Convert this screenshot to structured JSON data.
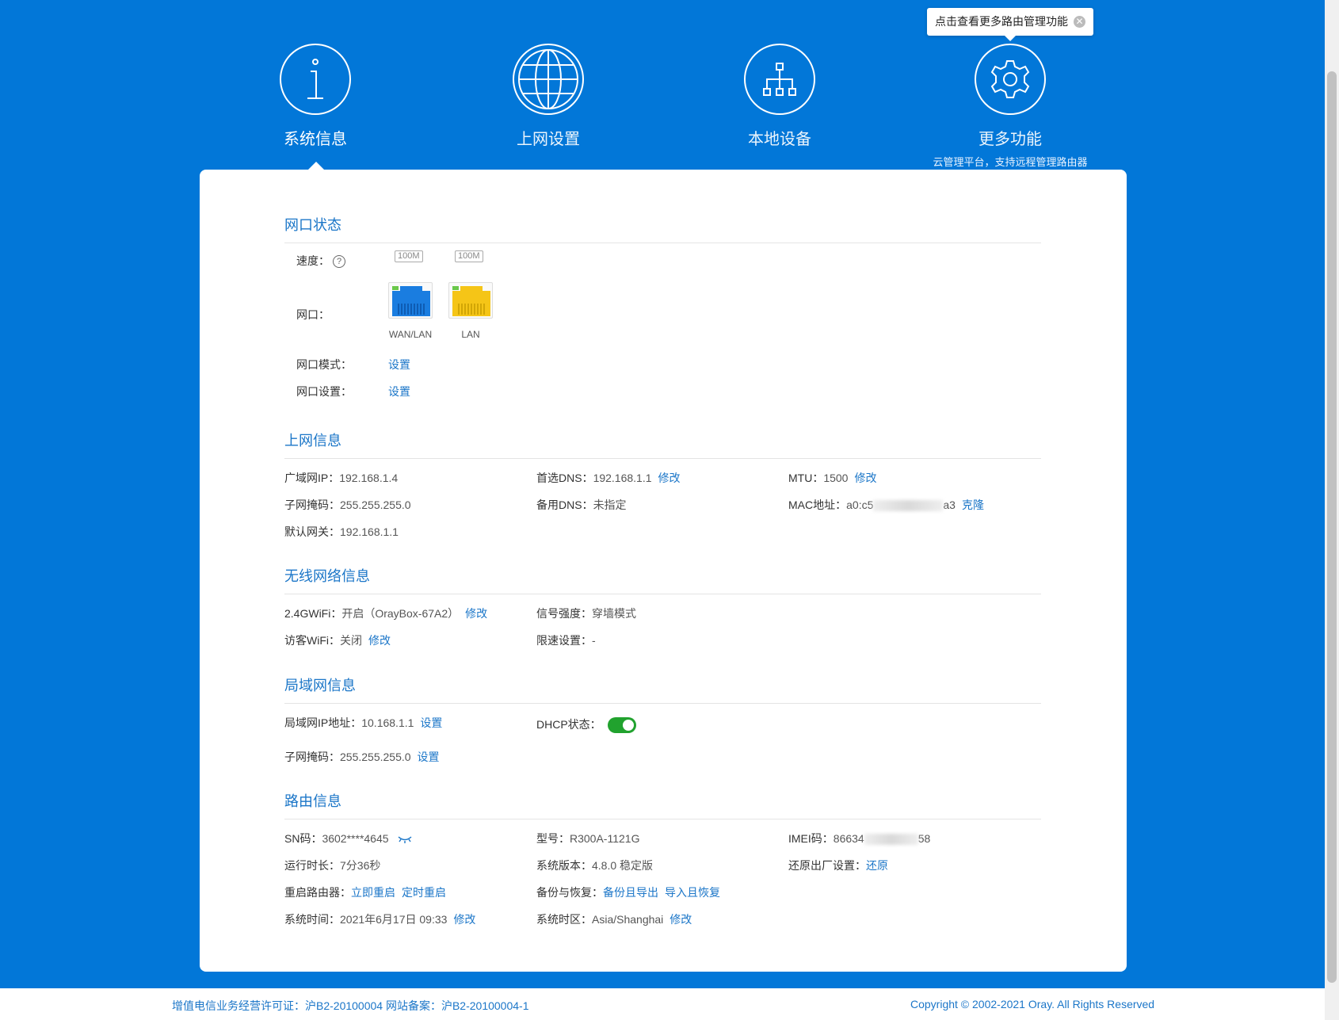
{
  "nav": {
    "items": [
      {
        "label": "系统信息",
        "icon": "info-icon"
      },
      {
        "label": "上网设置",
        "icon": "globe-icon"
      },
      {
        "label": "本地设备",
        "icon": "network-icon"
      },
      {
        "label": "更多功能",
        "icon": "gear-icon",
        "sub": "云管理平台，支持远程管理路由器"
      }
    ],
    "tooltip": "点击查看更多路由管理功能"
  },
  "port_status": {
    "title": "网口状态",
    "speed_label": "速度：",
    "speeds": [
      "100M",
      "100M"
    ],
    "port_label": "网口：",
    "ports": [
      {
        "name": "WAN/LAN",
        "color": "#1a7de0"
      },
      {
        "name": "LAN",
        "color": "#f5c517"
      }
    ],
    "mode_label": "网口模式：",
    "mode_link": "设置",
    "setting_label": "网口设置：",
    "setting_link": "设置"
  },
  "internet": {
    "title": "上网信息",
    "wan_ip_label": "广域网IP：",
    "wan_ip": "192.168.1.4",
    "mask_label": "子网掩码：",
    "mask": "255.255.255.0",
    "gateway_label": "默认网关：",
    "gateway": "192.168.1.1",
    "dns1_label": "首选DNS：",
    "dns1": "192.168.1.1",
    "dns1_link": "修改",
    "dns2_label": "备用DNS：",
    "dns2": "未指定",
    "mtu_label": "MTU：",
    "mtu": "1500",
    "mtu_link": "修改",
    "mac_label": "MAC地址：",
    "mac_prefix": "a0:c5",
    "mac_suffix": "a3",
    "mac_link": "克隆"
  },
  "wireless": {
    "title": "无线网络信息",
    "wifi24_label": "2.4GWiFi：",
    "wifi24": "开启（OrayBox-67A2）",
    "wifi24_link": "修改",
    "guest_label": "访客WiFi：",
    "guest": "关闭",
    "guest_link": "修改",
    "signal_label": "信号强度：",
    "signal": "穿墙模式",
    "limit_label": "限速设置：",
    "limit": "-"
  },
  "lan": {
    "title": "局域网信息",
    "ip_label": "局域网IP地址：",
    "ip": "10.168.1.1",
    "ip_link": "设置",
    "mask_label": "子网掩码：",
    "mask": "255.255.255.0",
    "mask_link": "设置",
    "dhcp_label": "DHCP状态：",
    "dhcp_on": true
  },
  "router": {
    "title": "路由信息",
    "sn_label": "SN码：",
    "sn": "3602****4645",
    "uptime_label": "运行时长：",
    "uptime": "7分36秒",
    "reboot_label": "重启路由器：",
    "reboot_now": "立即重启",
    "reboot_timer": "定时重启",
    "time_label": "系统时间：",
    "time": "2021年6月17日 09:33",
    "time_link": "修改",
    "model_label": "型号：",
    "model": "R300A-1121G",
    "version_label": "系统版本：",
    "version": "4.8.0 稳定版",
    "backup_label": "备份与恢复：",
    "backup_export": "备份且导出",
    "backup_import": "导入且恢复",
    "tz_label": "系统时区：",
    "tz": "Asia/Shanghai",
    "tz_link": "修改",
    "imei_label": "IMEI码：",
    "imei_prefix": "86634",
    "imei_suffix": "58",
    "reset_label": "还原出厂设置：",
    "reset_link": "还原"
  },
  "footer": {
    "left": "增值电信业务经营许可证：沪B2-20100004 网站备案：沪B2-20100004-1",
    "right": "Copyright © 2002-2021 Oray. All Rights Reserved"
  }
}
